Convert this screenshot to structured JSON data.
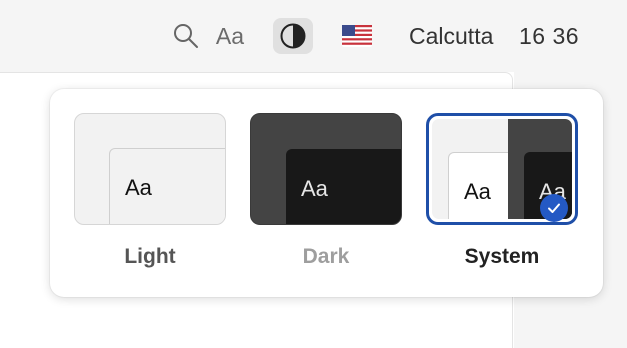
{
  "topbar": {
    "font_label": "Aa",
    "city": "Calcutta",
    "time": "16 36",
    "icons": {
      "search": "search-icon",
      "theme": "contrast-icon",
      "flag": "us-flag-icon"
    }
  },
  "theme_picker": {
    "selected": "System",
    "options": [
      {
        "label": "Light",
        "preview_text": "Aa"
      },
      {
        "label": "Dark",
        "preview_text": "Aa"
      },
      {
        "label": "System",
        "preview_text_light": "Aa",
        "preview_text_dark": "Aa"
      }
    ],
    "colors": {
      "selected_border": "#1f4fa8",
      "check_badge": "#2459c4",
      "dark_preview": "#444444",
      "light_preview": "#f2f2f2"
    }
  }
}
